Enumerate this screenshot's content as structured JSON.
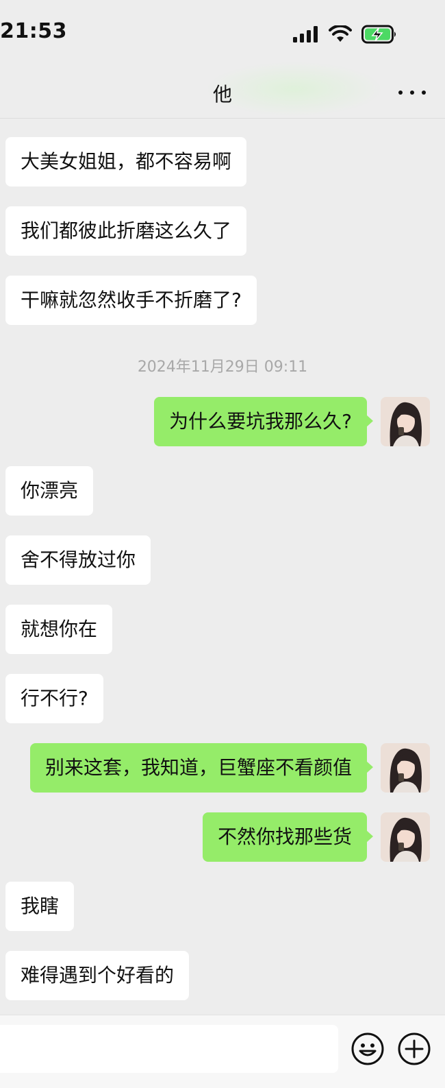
{
  "status_bar": {
    "time": "21:53"
  },
  "nav": {
    "title": "他"
  },
  "messages": [
    {
      "side": "left",
      "text": "大美女姐姐，都不容易啊"
    },
    {
      "side": "left",
      "text": "我们都彼此折磨这么久了"
    },
    {
      "side": "left",
      "text": "干嘛就忽然收手不折磨了?"
    },
    {
      "type": "timestamp",
      "text": "2024年11月29日 09:11"
    },
    {
      "side": "right",
      "text": "为什么要坑我那么久?"
    },
    {
      "side": "left",
      "text": "你漂亮"
    },
    {
      "side": "left",
      "text": "舍不得放过你"
    },
    {
      "side": "left",
      "text": "就想你在"
    },
    {
      "side": "left",
      "text": "行不行?"
    },
    {
      "side": "right",
      "text": "别来这套，我知道，巨蟹座不看颜值"
    },
    {
      "side": "right",
      "text": "不然你找那些货"
    },
    {
      "side": "left",
      "text": "我瞎"
    },
    {
      "side": "left",
      "text": "难得遇到个好看的"
    }
  ],
  "input_bar": {
    "placeholder": "",
    "emoji_icon": "emoji-icon",
    "plus_icon": "plus-icon"
  },
  "colors": {
    "background": "#ededed",
    "received_bubble": "#ffffff",
    "sent_bubble": "#95ec69",
    "timestamp_text": "#a8a8a8"
  }
}
